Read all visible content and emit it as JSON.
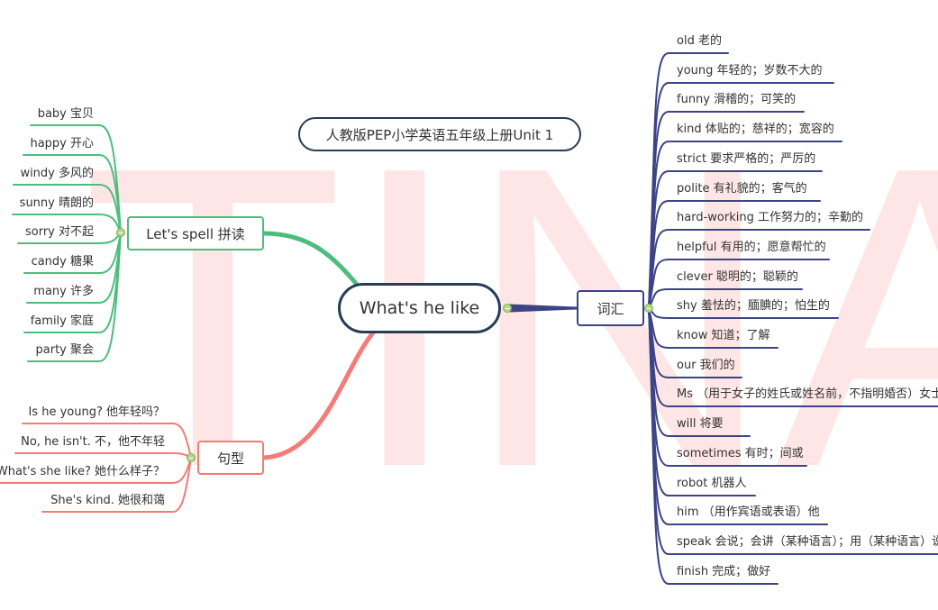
{
  "watermark": {
    "text": "TINA",
    "color": "#ffe6e6"
  },
  "title": {
    "text": "人教版PEP小学英语五年级上册Unit 1"
  },
  "central": {
    "text": "What's he like",
    "color": "#263d55"
  },
  "branches": {
    "spell": {
      "label": "Let's spell 拼读",
      "color": "#4dbd7e",
      "items": [
        "baby 宝贝",
        "happy 开心",
        "windy 多风的",
        "sunny 晴朗的",
        "sorry 对不起",
        "candy 糖果",
        "many 许多",
        "family 家庭",
        "party 聚会"
      ]
    },
    "sentences": {
      "label": "句型",
      "color": "#f47b78",
      "items": [
        "Is he young? 他年轻吗？",
        "No, he isn't. 不，他不年轻",
        "What's she like? 她什么样子？",
        "She's kind.  她很和蔼"
      ]
    },
    "vocab": {
      "label": "词汇",
      "color": "#3c4486",
      "items": [
        "old 老的",
        " young 年轻的；岁数不大的",
        "funny 滑稽的；可笑的",
        "kind 体贴的；慈祥的；宽容的",
        "strict 要求严格的；严厉的",
        "polite 有礼貌的；客气的",
        "hard-working 工作努力的；辛勤的",
        "helpful 有用的；愿意帮忙的",
        "clever 聪明的；聪颖的",
        "shy 羞怯的；腼腆的；怕生的",
        "know 知道；了解",
        "our 我们的",
        "Ms （用于女子的姓氏或姓名前，不指明婚否）女士",
        "will 将要",
        "sometimes 有时；间或",
        "robot 机器人",
        "him （用作宾语或表语）他",
        "speak 会说；会讲（某种语言）；用（某种语言）说话",
        "finish 完成；做好"
      ]
    }
  }
}
